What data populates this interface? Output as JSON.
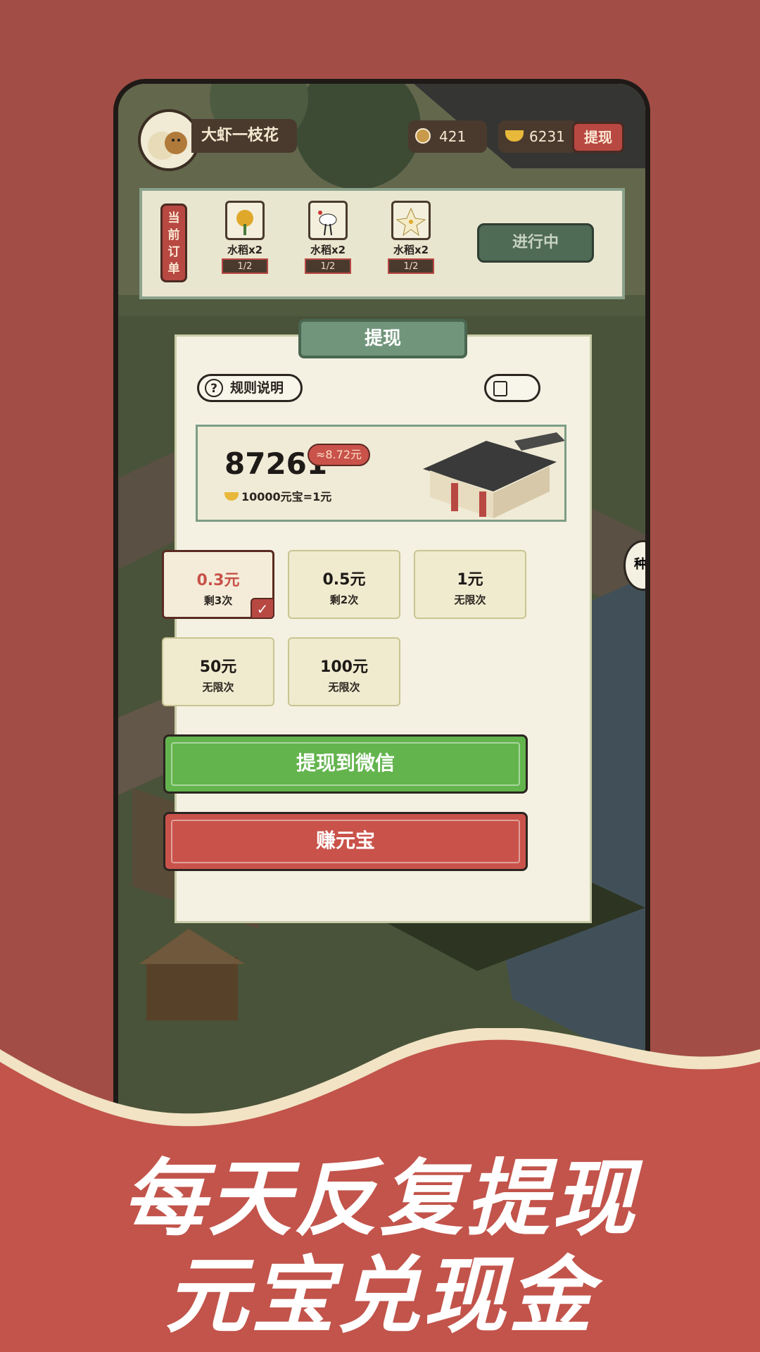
{
  "player": {
    "name": "大虾一枝花",
    "coins": "421",
    "ingots": "6231",
    "withdraw_label": "提现"
  },
  "order": {
    "tag": "当前订单",
    "items": [
      {
        "name": "水稻x2",
        "progress": "1/2",
        "icon": "rice-flower-icon"
      },
      {
        "name": "水稻x2",
        "progress": "1/2",
        "icon": "crane-icon"
      },
      {
        "name": "水稻x2",
        "progress": "1/2",
        "icon": "lily-flower-icon"
      }
    ],
    "status": "进行中"
  },
  "dialog": {
    "title": "提现",
    "rules_label": "规则说明",
    "rules_icon": "?",
    "balance": "87261",
    "approx": "≈8.72元",
    "rate": "10000元宝=1元",
    "options": [
      {
        "amount": "0.3元",
        "count": "剩3次",
        "selected": true
      },
      {
        "amount": "0.5元",
        "count": "剩2次",
        "selected": false
      },
      {
        "amount": "1元",
        "count": "无限次",
        "selected": false
      },
      {
        "amount": "50元",
        "count": "无限次",
        "selected": false
      },
      {
        "amount": "100元",
        "count": "无限次",
        "selected": false
      }
    ],
    "check_mark": "✓",
    "wechat_button": "提现到微信",
    "earn_button": "赚元宝"
  },
  "side_bubble": "种",
  "slogan": {
    "line1": "每天反复提现",
    "line2": "元宝兑现金"
  },
  "colors": {
    "background": "#a24e46",
    "accent_red": "#c9524a",
    "accent_green": "#63b44d",
    "panel": "#f4f1e2",
    "banner": "#71957b"
  }
}
